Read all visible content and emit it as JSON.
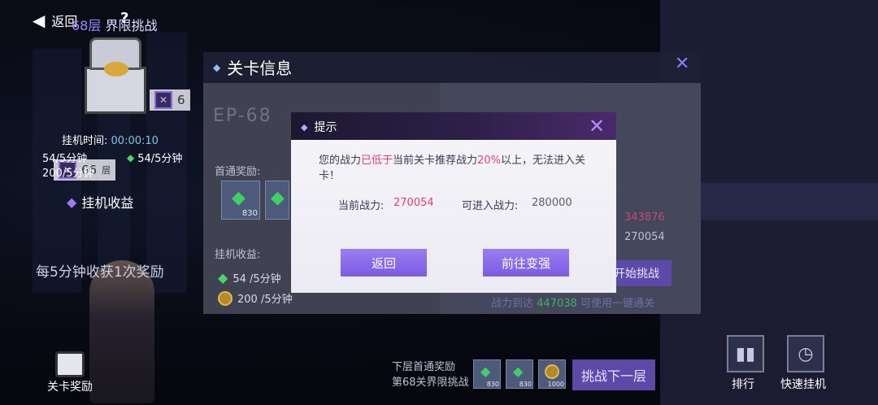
{
  "topbar": {
    "back_label": "返回",
    "help_label": "?"
  },
  "map": {
    "stage_66": "66",
    "stage_66_suffix": "层",
    "stage_upper": "6"
  },
  "right_panel": {
    "floor": "68层",
    "title": "界限挑战",
    "idle_time_label": "挂机时间:",
    "idle_time_value": "00:00:10",
    "rate_gem_left": "54/5分钟",
    "rate_gem_right": "54/5分钟",
    "rate_coin_left": "200/5分钟",
    "earnings_label": "挂机收益",
    "notice": "每5分钟收获1次奖励",
    "rank_label": "排行",
    "quick_idle_label": "快速挂机"
  },
  "stage_info": {
    "title": "关卡信息",
    "ep_label": "EP-68",
    "normal_reward_label": "首通奖励:",
    "reward1_count": "830",
    "idle_reward_label": "挂机收益:",
    "idle_gem_rate": "54 /5分钟",
    "idle_coin_rate": "200 /5分钟",
    "recommended_power": "343876",
    "my_power": "270054",
    "challenge_label": "开始挑战",
    "sweep_prefix": "战力到达",
    "sweep_value": "447038",
    "sweep_suffix": "可使用一键通关"
  },
  "bottom": {
    "next_reward_line1": "下层首通奖励",
    "next_reward_line2": "第68关界限挑战",
    "reward_counts": [
      "830",
      "830",
      "1000"
    ],
    "next_challenge_label": "挑战下一层",
    "stage_reward_label": "关卡奖励"
  },
  "dialog": {
    "title": "提示",
    "msg_part1": "您的战力",
    "msg_highlight1": "已低于",
    "msg_part2": "当前关卡推荐战力",
    "msg_highlight2": "20%",
    "msg_part3": "以上，无法进入关卡！",
    "current_power_label": "当前战力:",
    "current_power_value": "270054",
    "required_power_label": "可进入战力:",
    "required_power_value": "280000",
    "back_button": "返回",
    "strengthen_button": "前往变强"
  },
  "colors": {
    "accent_purple": "#7b5ce0",
    "highlight_pink": "#e0407a",
    "gem_green": "#3fd06a"
  }
}
